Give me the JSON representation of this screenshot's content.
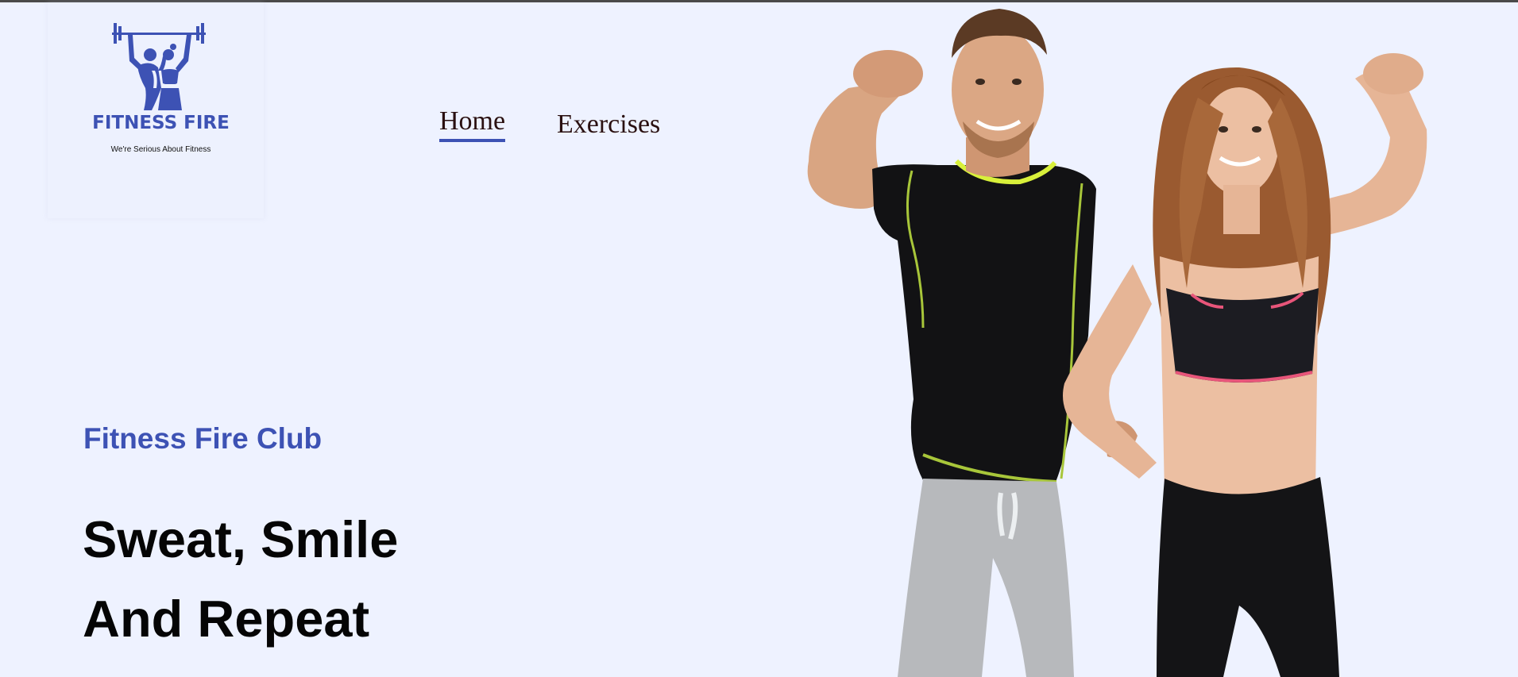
{
  "colors": {
    "background": "#eef2ff",
    "brand_blue": "#3d52b4",
    "nav_text": "#2a1010",
    "headline_text": "#050505"
  },
  "logo": {
    "icon": "weightlifting-couple-icon",
    "title": "FITNESS FIRE",
    "tagline": "We're Serious About Fitness"
  },
  "nav": {
    "items": [
      {
        "label": "Home",
        "active": true
      },
      {
        "label": "Exercises",
        "active": false
      }
    ]
  },
  "hero": {
    "eyebrow": "Fitness Fire Club",
    "headline_line1": "Sweat, Smile",
    "headline_line2": "And Repeat",
    "image": "fit-couple-flexing-photo"
  }
}
